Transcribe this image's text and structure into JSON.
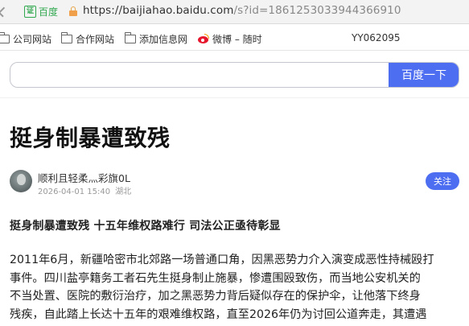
{
  "browser": {
    "badge_label": "百度",
    "url_host": "https://baijiahao.baidu.com",
    "url_path": "/s?id=1861253033944366910"
  },
  "bookmarks": {
    "items": [
      {
        "label": "公司网站",
        "icon": "folder-icon"
      },
      {
        "label": "合作网站",
        "icon": "folder-icon"
      },
      {
        "label": "添加信息网",
        "icon": "folder-icon"
      },
      {
        "label": "微博 – 随时",
        "icon": "weibo-icon"
      }
    ],
    "extra_label": "YY062095"
  },
  "search": {
    "value": "",
    "placeholder": "",
    "button_label": "百度一下"
  },
  "article": {
    "title": "挺身制暴遭致残",
    "author_name": "顺利且轻柔灬彩旗0L",
    "publish_time": "2026-04-01 15:40",
    "location": "湖北",
    "follow_label": "关注",
    "subheading": "挺身制暴遭致残 十五年维权路难行 司法公正亟待彰显",
    "paragraph_lines": [
      "2011年6月，新疆哈密市北郊路一场普通口角，因黑恶势力介入演变成恶性持械殴打",
      "事件。四川盐亭籍务工者石先生挺身制止施暴，惨遭围殴致伤，而当地公安机关的",
      "不当处置、医院的敷衍治疗，加之黑恶势力背后疑似存在的保护伞，让他落下终身",
      "残疾，自此踏上长达十五年的艰难维权路，直至2026年仍为讨回公道奔走，其遭遇"
    ]
  },
  "colors": {
    "accent": "#4e6ef2",
    "secure_green": "#31a84f"
  }
}
